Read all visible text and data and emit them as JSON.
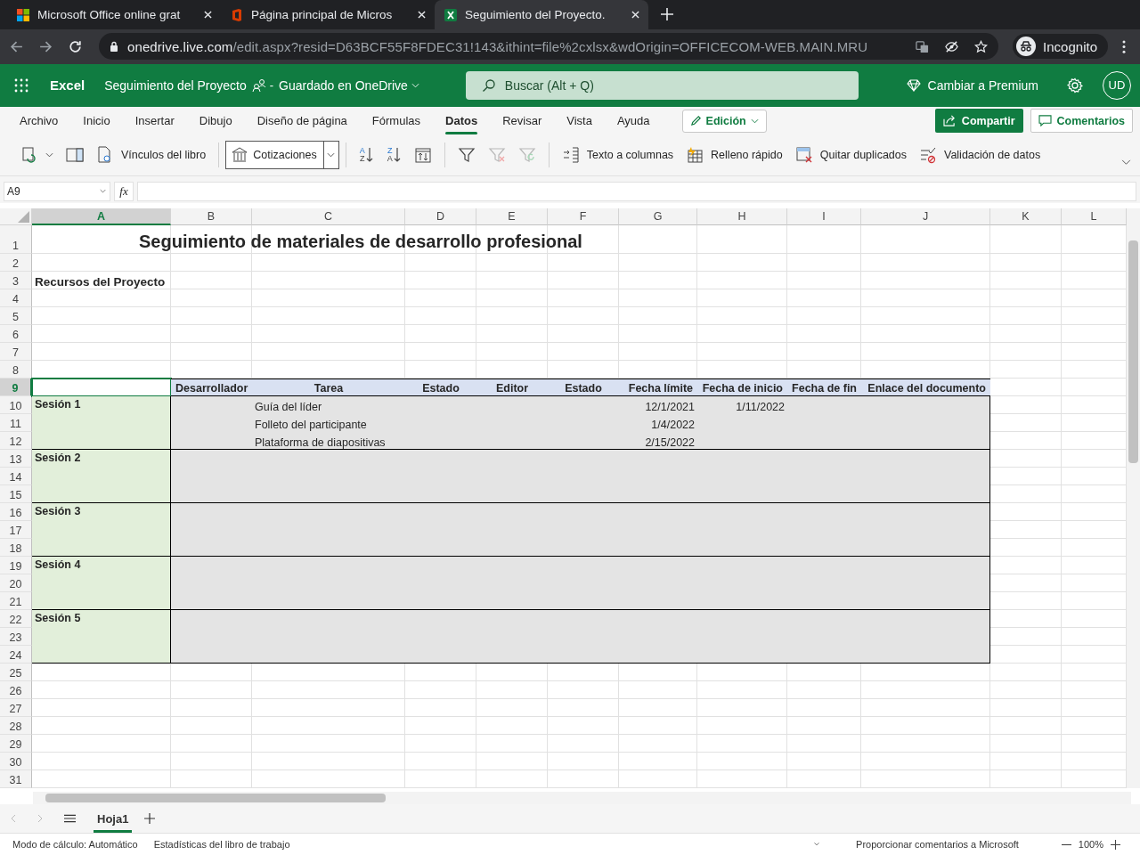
{
  "browser": {
    "tabs": [
      {
        "title": "Microsoft Office online grat",
        "selected": false
      },
      {
        "title": "Página principal de Micros",
        "selected": false
      },
      {
        "title": "Seguimiento del Proyecto.",
        "selected": true
      }
    ],
    "url": {
      "host": "onedrive.live.com",
      "path": "/edit.aspx?resid=D63BCF55F8FDEC31!143&ithint=file%2cxlsx&wdOrigin=OFFICECOM-WEB.MAIN.MRU"
    },
    "profile": "Incognito"
  },
  "app_bar": {
    "app_name": "Excel",
    "doc_title": "Seguimiento del Proyecto",
    "separator": "-",
    "save_status": "Guardado en OneDrive",
    "search": {
      "placeholder": "Buscar (Alt + Q)"
    },
    "premium": "Cambiar a Premium",
    "avatar": "UD"
  },
  "ribbon_tabs": [
    {
      "label": "Archivo",
      "selected": false
    },
    {
      "label": "Inicio",
      "selected": false
    },
    {
      "label": "Insertar",
      "selected": false
    },
    {
      "label": "Dibujo",
      "selected": false
    },
    {
      "label": "Diseño de página",
      "selected": false
    },
    {
      "label": "Fórmulas",
      "selected": false
    },
    {
      "label": "Datos",
      "selected": true
    },
    {
      "label": "Revisar",
      "selected": false
    },
    {
      "label": "Vista",
      "selected": false
    },
    {
      "label": "Ayuda",
      "selected": false
    }
  ],
  "mode_button": "Edición",
  "share_button": "Compartir",
  "comments_button": "Comentarios",
  "toolbar": {
    "links_button": "Vínculos del libro",
    "stocks_button": "Cotizaciones",
    "sort_buttons": [
      {
        "top": "A",
        "bottom": "Z"
      },
      {
        "top": "Z",
        "bottom": "A"
      }
    ],
    "filter_buttons": [
      {
        "disabled": false
      },
      {
        "disabled": true
      },
      {
        "disabled": true
      }
    ],
    "tools": [
      {
        "label": "Texto a columnas"
      },
      {
        "label": "Relleno rápido"
      },
      {
        "label": "Quitar duplicados"
      },
      {
        "label": "Validación de datos"
      }
    ]
  },
  "formula_bar": {
    "name_box": "A9",
    "fx": "fx"
  },
  "sheet": {
    "columns": [
      {
        "label": "A",
        "selected": true
      },
      {
        "label": "B",
        "selected": false
      },
      {
        "label": "C",
        "selected": false
      },
      {
        "label": "D",
        "selected": false
      },
      {
        "label": "E",
        "selected": false
      },
      {
        "label": "F",
        "selected": false
      },
      {
        "label": "G",
        "selected": false
      },
      {
        "label": "H",
        "selected": false
      },
      {
        "label": "I",
        "selected": false
      },
      {
        "label": "J",
        "selected": false
      },
      {
        "label": "K",
        "selected": false
      },
      {
        "label": "L",
        "selected": false
      }
    ],
    "rows": [
      {
        "label": "1",
        "selected": false
      },
      {
        "label": "2",
        "selected": false
      },
      {
        "label": "3",
        "selected": false
      },
      {
        "label": "4",
        "selected": false
      },
      {
        "label": "5",
        "selected": false
      },
      {
        "label": "6",
        "selected": false
      },
      {
        "label": "7",
        "selected": false
      },
      {
        "label": "8",
        "selected": false
      },
      {
        "label": "9",
        "selected": true
      },
      {
        "label": "10",
        "selected": false
      },
      {
        "label": "11",
        "selected": false
      },
      {
        "label": "12",
        "selected": false
      },
      {
        "label": "13",
        "selected": false
      },
      {
        "label": "14",
        "selected": false
      },
      {
        "label": "15",
        "selected": false
      },
      {
        "label": "16",
        "selected": false
      },
      {
        "label": "17",
        "selected": false
      },
      {
        "label": "18",
        "selected": false
      },
      {
        "label": "19",
        "selected": false
      },
      {
        "label": "20",
        "selected": false
      },
      {
        "label": "21",
        "selected": false
      },
      {
        "label": "22",
        "selected": false
      },
      {
        "label": "23",
        "selected": false
      },
      {
        "label": "24",
        "selected": false
      },
      {
        "label": "25",
        "selected": false
      },
      {
        "label": "26",
        "selected": false
      },
      {
        "label": "27",
        "selected": false
      },
      {
        "label": "28",
        "selected": false
      },
      {
        "label": "29",
        "selected": false
      },
      {
        "label": "30",
        "selected": false
      },
      {
        "label": "31",
        "selected": false
      }
    ],
    "title": "Seguimiento de materiales de desarrollo profesional",
    "subtitle": "Recursos del Proyecto",
    "table_headers": [
      "Desarrollador",
      "Tarea",
      "Estado",
      "Editor",
      "Estado",
      "Fecha límite",
      "Fecha de inicio",
      "Fecha de fin",
      "Enlace del documento"
    ],
    "sessions": [
      {
        "label": "Sesión 1",
        "tasks": [
          {
            "task": "Guía del líder",
            "deadline": "12/1/2021",
            "start": "1/11/2022"
          },
          {
            "task": "Folleto del participante",
            "deadline": "1/4/2022"
          },
          {
            "task": "Plataforma de diapositivas",
            "deadline": "2/15/2022"
          }
        ]
      },
      {
        "label": "Sesión 2"
      },
      {
        "label": "Sesión 3"
      },
      {
        "label": "Sesión 4"
      },
      {
        "label": "Sesión 5"
      }
    ]
  },
  "sheet_tabs": [
    {
      "label": "Hoja1",
      "selected": true
    }
  ],
  "status_bar": {
    "calc_mode": "Modo de cálculo: Automático",
    "stats": "Estadísticas del libro de trabajo",
    "feedback": "Proporcionar comentarios a Microsoft",
    "zoom": "100%"
  }
}
